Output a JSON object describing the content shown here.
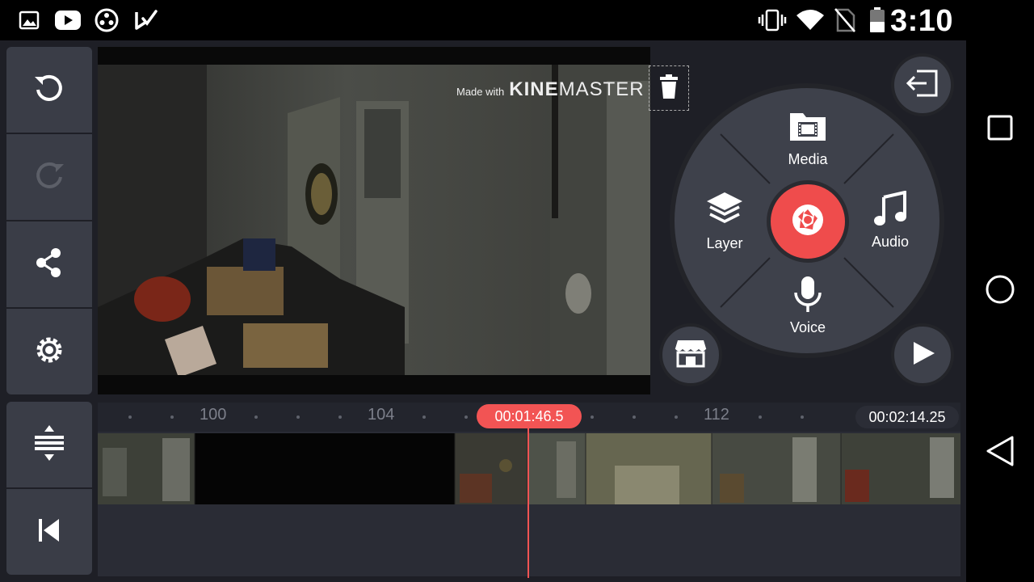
{
  "status_bar": {
    "time": "3:10",
    "left_icons": [
      "gallery-icon",
      "youtube-icon",
      "app-circle-icon",
      "tasks-icon"
    ],
    "right_icons": [
      "vibrate-icon",
      "wifi-icon",
      "no-sim-icon",
      "battery-icon"
    ]
  },
  "sidebar": {
    "buttons": [
      {
        "name": "undo-button",
        "icon": "undo-icon"
      },
      {
        "name": "redo-button",
        "icon": "redo-icon"
      },
      {
        "name": "share-button",
        "icon": "share-icon"
      },
      {
        "name": "settings-button",
        "icon": "gear-icon"
      },
      {
        "name": "timeline-expand-button",
        "icon": "expand-icon"
      },
      {
        "name": "jump-start-button",
        "icon": "skip-start-icon"
      }
    ]
  },
  "preview": {
    "watermark_small": "Made with",
    "watermark_brand_bold": "KINE",
    "watermark_brand_light": "MASTER"
  },
  "wheel": {
    "media_label": "Media",
    "layer_label": "Layer",
    "audio_label": "Audio",
    "voice_label": "Voice"
  },
  "timeline": {
    "ticks": [
      "100",
      "104",
      "112"
    ],
    "current_time": "00:01:46.5",
    "total_time": "00:02:14.25"
  },
  "colors": {
    "accent": "#ef4c4c",
    "panel": "#3a3d47",
    "background": "#1e1f26"
  }
}
